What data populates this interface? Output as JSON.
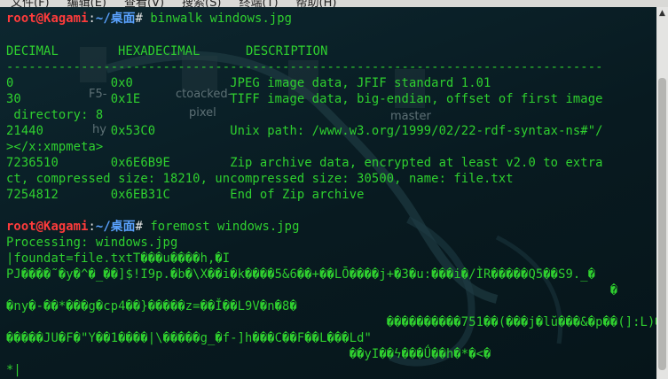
{
  "menu": {
    "items": [
      "文件(F)",
      "编辑(E)",
      "查看(V)",
      "搜索(S)",
      "终端(T)",
      "帮助(H)"
    ]
  },
  "desktop_labels": [
    "F5-",
    "hy",
    "ctoacked-",
    "pixel",
    "master"
  ],
  "terminal": {
    "prompt1": {
      "user": "root@Kagami",
      "sep": ":",
      "path": "~/桌面",
      "hash": "#",
      "command": " binwalk windows.jpg"
    },
    "header": {
      "col1": "DECIMAL",
      "col2": "HEXADECIMAL",
      "col3": "DESCRIPTION"
    },
    "divider": "--------------------------------------------------------------------------------",
    "rows": [
      "0             0x0             JPEG image data, JFIF standard 1.01",
      "30            0x1E            TIFF image data, big-endian, offset of first image",
      " directory: 8",
      "21440         0x53C0          Unix path: /www.w3.org/1999/02/22-rdf-syntax-ns#\"/",
      "></x:xmpmeta>",
      "7236510       0x6E6B9E        Zip archive data, encrypted at least v2.0 to extra",
      "ct, compressed size: 18210, uncompressed size: 30500, name: file.txt",
      "7254812       0x6EB31C        End of Zip archive"
    ],
    "prompt2": {
      "user": "root@Kagami",
      "sep": ":",
      "path": "~/桌面",
      "hash": "#",
      "command": " foremost windows.jpg"
    },
    "output": [
      "Processing: windows.jpg",
      "|foundat=file.txtT���u����h,�I",
      "PJ����˜�y�^�_��]$!I9p.�b�\\X��i�k����5&6��+��LŌ����j+�3�u:���i�/ÌR�����Q5��S9._�",
      "                                                                                 �",
      "�ny�-��*���g�cp4��}�����z=��Ǐ��L9V�n�8�",
      "                                                   ����������751��(���j�lŭ���&�p��(]:L)�",
      "�����JU�F�\"Y��1����|\\�����g_�f-]h���C��F��L���Ld\"",
      "                                              ��yI��ϟ���Ǘ��h�*�<�",
      "",
      "*|"
    ]
  },
  "colors": {
    "background": "#0b1f26",
    "text": "#2fd02f",
    "prompt_user": "#ff3b3b",
    "prompt_path": "#5aa2ff"
  }
}
